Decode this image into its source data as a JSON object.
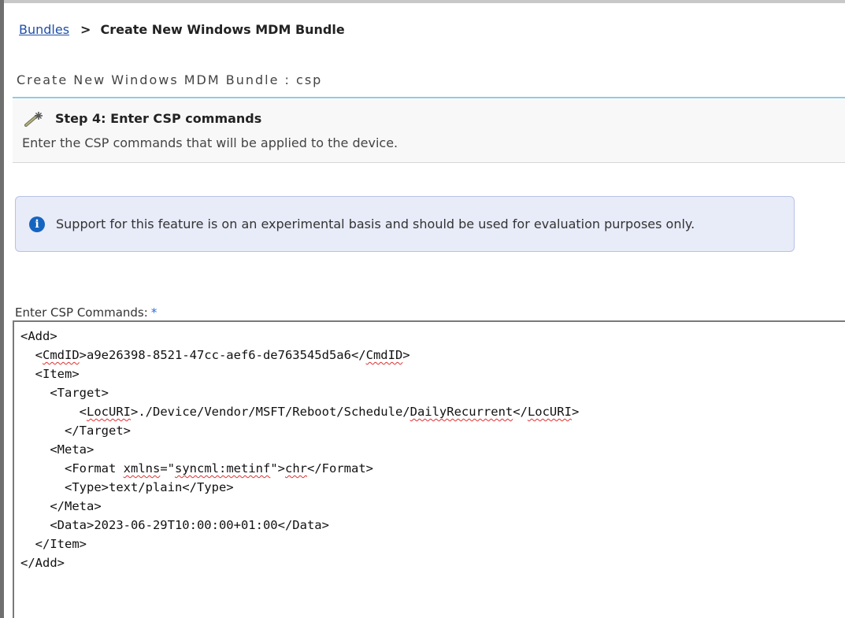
{
  "breadcrumb": {
    "link": "Bundles",
    "separator": ">",
    "current": "Create New Windows MDM Bundle"
  },
  "page_heading": "Create New Windows MDM Bundle : csp",
  "step": {
    "icon": "wand-icon",
    "title": "Step 4: Enter CSP commands",
    "description": "Enter the CSP commands that will be applied to the device."
  },
  "notice": {
    "icon": "info-icon",
    "icon_glyph": "i",
    "text": "Support for this feature is on an experimental basis and should be used for evaluation purposes only."
  },
  "csp_field": {
    "label": "Enter CSP Commands:",
    "required_marker": "*",
    "lines": [
      "<Add>",
      "  <CmdID>a9e26398-8521-47cc-aef6-de763545d5a6</CmdID>",
      "  <Item>",
      "    <Target>",
      "        <LocURI>./Device/Vendor/MSFT/Reboot/Schedule/DailyRecurrent</LocURI>",
      "      </Target>",
      "    <Meta>",
      "      <Format xmlns=\"syncml:metinf\">chr</Format>",
      "      <Type>text/plain</Type>",
      "    </Meta>",
      "    <Data>2023-06-29T10:00:00+01:00</Data>",
      "  </Item>",
      "</Add>"
    ],
    "spellcheck_flagged_words": [
      "CmdID",
      "LocURI",
      "DailyRecurrent",
      "xmlns",
      "syncml:metinf",
      "chr"
    ]
  },
  "colors": {
    "link": "#1f4fa8",
    "info_icon": "#1565c0",
    "heading_rule": "#8ecbe6",
    "spellcheck": "#e03030"
  }
}
